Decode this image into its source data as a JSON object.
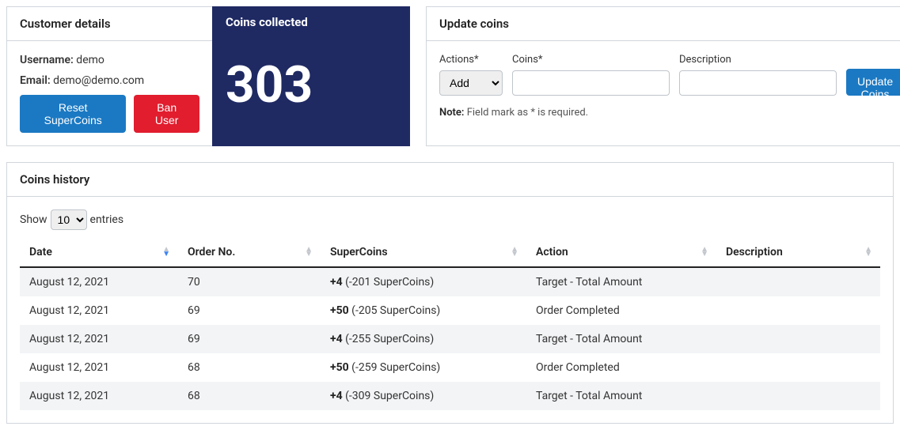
{
  "customer": {
    "title": "Customer details",
    "username_label": "Username:",
    "username_value": "demo",
    "email_label": "Email:",
    "email_value": "demo@demo.com",
    "reset_btn": "Reset SuperCoins",
    "ban_btn": "Ban User"
  },
  "coins": {
    "title": "Coins collected",
    "value": "303"
  },
  "update": {
    "title": "Update coins",
    "actions_label": "Actions*",
    "actions_selected": "Add",
    "coins_label": "Coins*",
    "coins_value": "",
    "description_label": "Description",
    "description_value": "",
    "submit_btn": "Update Coins",
    "note_label": "Note:",
    "note_text": "Field mark as * is required."
  },
  "history": {
    "title": "Coins history",
    "show_label": "Show",
    "entries_label": "entries",
    "page_size": "10",
    "columns": {
      "date": "Date",
      "order_no": "Order No.",
      "supercoins": "SuperCoins",
      "action": "Action",
      "description": "Description"
    },
    "rows": [
      {
        "date": "August 12, 2021",
        "order_no": "70",
        "sc_delta": "+4",
        "sc_balance": "(-201 SuperCoins)",
        "action": "Target - Total Amount",
        "description": ""
      },
      {
        "date": "August 12, 2021",
        "order_no": "69",
        "sc_delta": "+50",
        "sc_balance": "(-205 SuperCoins)",
        "action": "Order Completed",
        "description": ""
      },
      {
        "date": "August 12, 2021",
        "order_no": "69",
        "sc_delta": "+4",
        "sc_balance": "(-255 SuperCoins)",
        "action": "Target - Total Amount",
        "description": ""
      },
      {
        "date": "August 12, 2021",
        "order_no": "68",
        "sc_delta": "+50",
        "sc_balance": "(-259 SuperCoins)",
        "action": "Order Completed",
        "description": ""
      },
      {
        "date": "August 12, 2021",
        "order_no": "68",
        "sc_delta": "+4",
        "sc_balance": "(-309 SuperCoins)",
        "action": "Target - Total Amount",
        "description": ""
      }
    ]
  }
}
